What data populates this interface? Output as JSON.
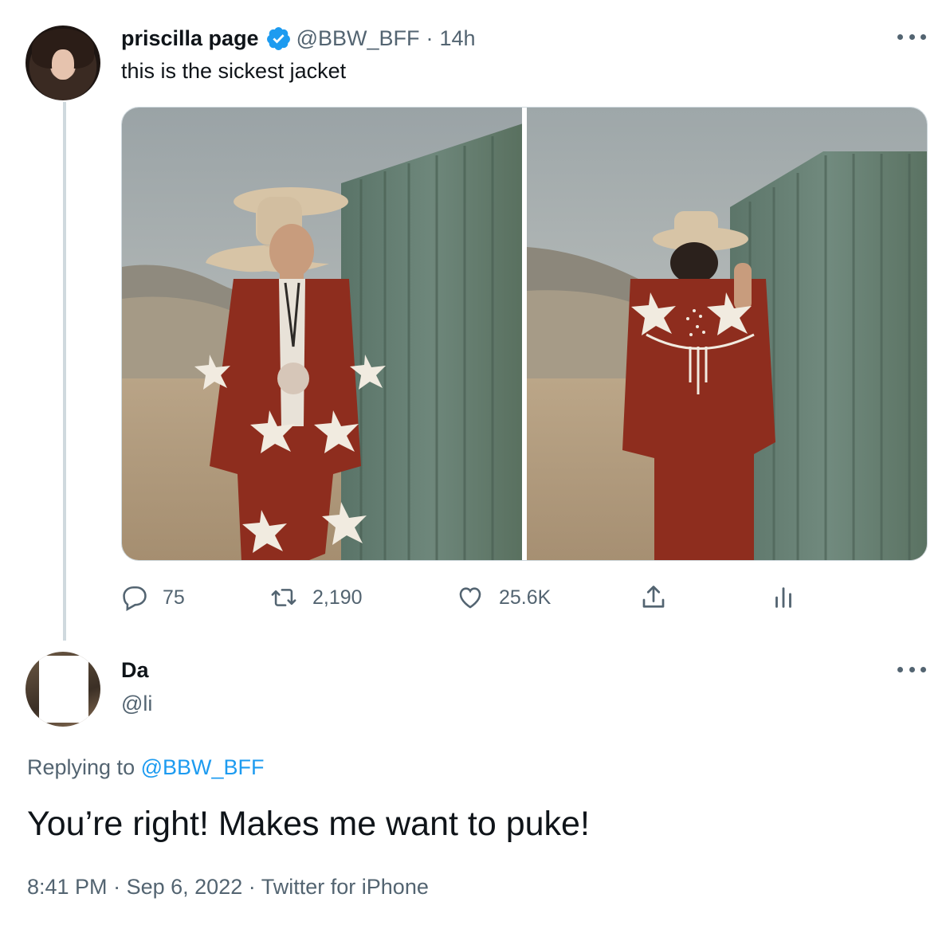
{
  "tweet": {
    "author_name": "priscilla page",
    "author_handle": "@BBW_BFF",
    "time_ago": "14h",
    "separator": "·",
    "text": "this is the sickest jacket",
    "verified": true,
    "stats": {
      "replies": "75",
      "retweets": "2,190",
      "likes": "25.6K"
    }
  },
  "reply": {
    "author_name": "Da",
    "author_handle": "@li",
    "replying_prefix": "Replying to",
    "replying_mention": "@BBW_BFF",
    "text": "You’re right! Makes me want to puke!",
    "time": "8:41 PM",
    "date": "Sep 6, 2022",
    "source": "Twitter for iPhone",
    "separator": "·"
  },
  "colors": {
    "verified_blue": "#1d9bf0",
    "secondary_text": "#536471",
    "primary_text": "#0f1419",
    "border": "#cfd9de"
  },
  "icons": [
    "verified-badge-icon",
    "more-icon",
    "reply-icon",
    "retweet-icon",
    "like-icon",
    "share-icon",
    "analytics-icon"
  ]
}
